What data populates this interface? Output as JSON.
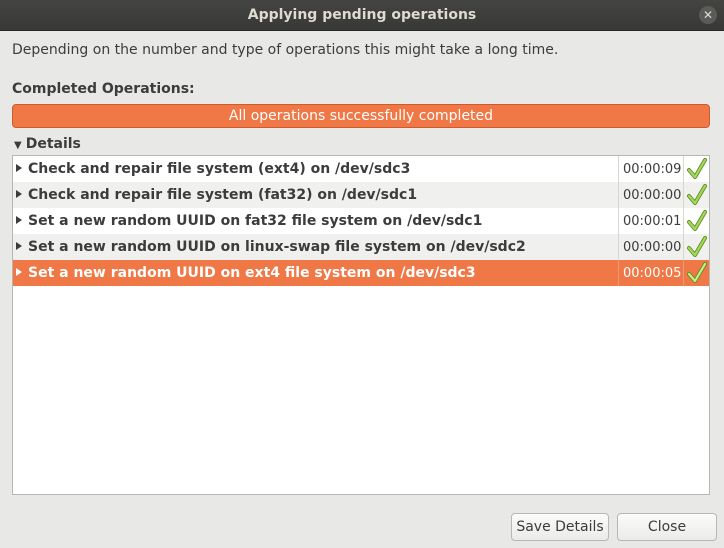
{
  "window": {
    "title": "Applying pending operations",
    "close_glyph": "✕"
  },
  "description": "Depending on the number and type of operations this might take a long time.",
  "completed_label": "Completed Operations:",
  "progress": {
    "text": "All operations successfully completed",
    "fraction": 1.0,
    "color": "#f07746"
  },
  "details": {
    "label": "Details",
    "expanded": true
  },
  "operations": [
    {
      "label": "Check and repair file system (ext4) on /dev/sdc3",
      "time": "00:00:09",
      "status": "check-icon",
      "selected": false
    },
    {
      "label": "Check and repair file system (fat32) on /dev/sdc1",
      "time": "00:00:00",
      "status": "check-icon",
      "selected": false
    },
    {
      "label": "Set a new random UUID on fat32 file system on /dev/sdc1",
      "time": "00:00:01",
      "status": "check-icon",
      "selected": false
    },
    {
      "label": "Set a new random UUID on linux-swap file system on /dev/sdc2",
      "time": "00:00:00",
      "status": "check-icon",
      "selected": false
    },
    {
      "label": "Set a new random UUID on ext4 file system on /dev/sdc3",
      "time": "00:00:05",
      "status": "check-icon",
      "selected": true
    }
  ],
  "buttons": {
    "save": "Save Details",
    "close": "Close"
  },
  "colors": {
    "accent": "#f07746",
    "check": "#8ec63f"
  }
}
